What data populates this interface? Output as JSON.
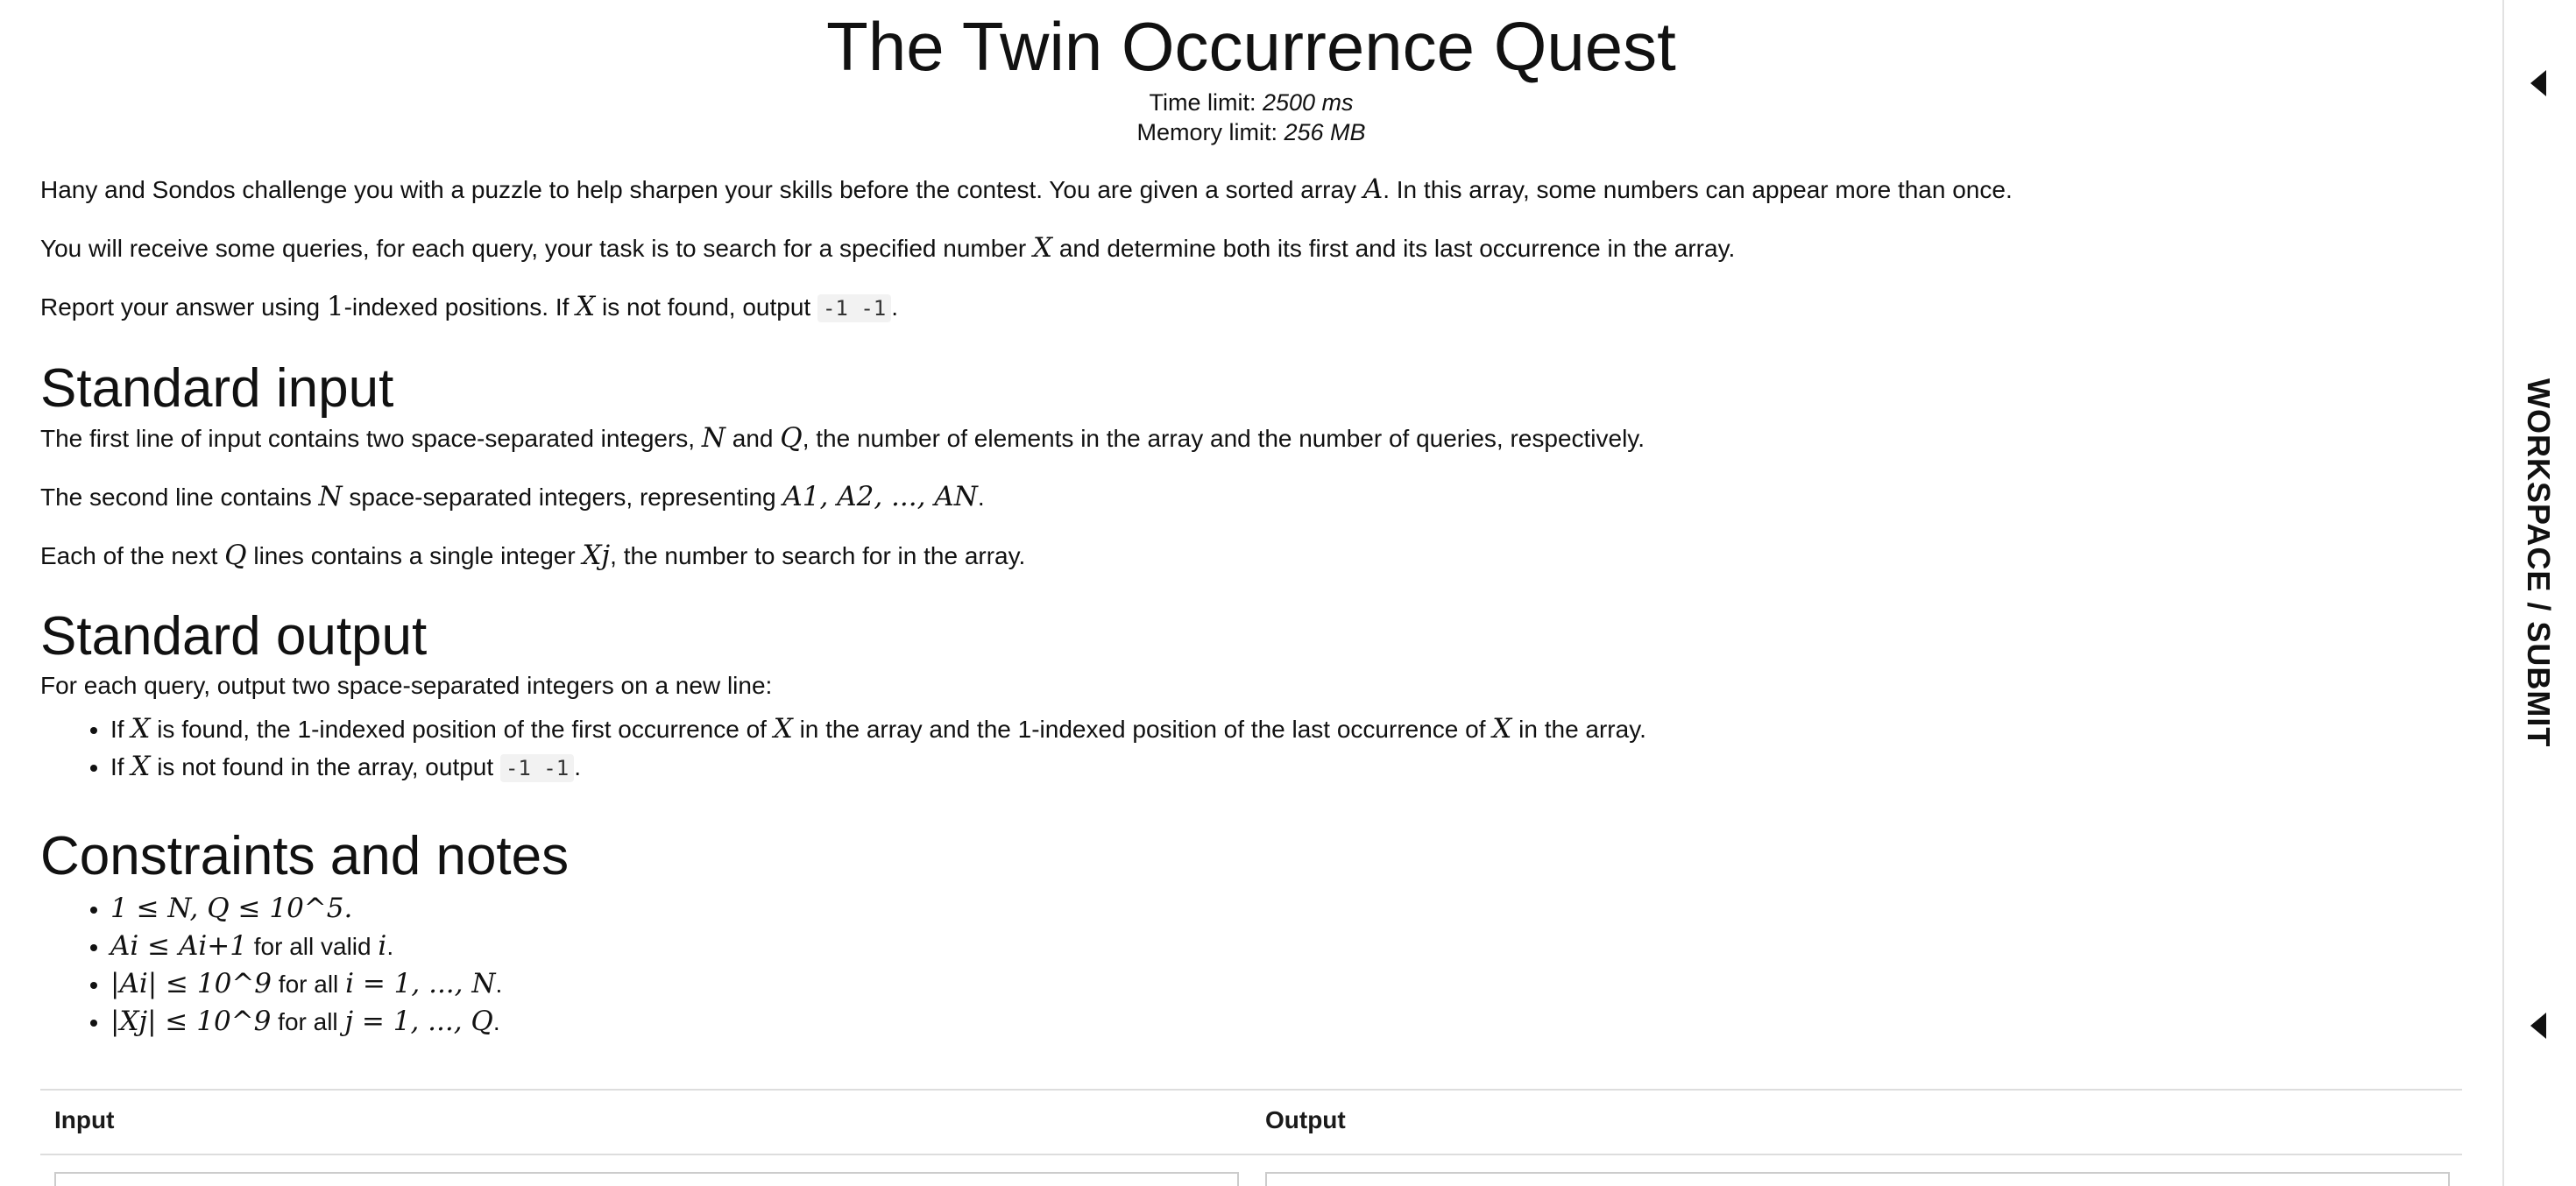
{
  "problem": {
    "title": "The Twin Occurrence Quest",
    "time_limit_label": "Time limit: ",
    "time_limit_value": "2500 ms",
    "memory_limit_label": "Memory limit: ",
    "memory_limit_value": "256 MB"
  },
  "statement": {
    "p1_a": "Hany and Sondos challenge you with a puzzle to help sharpen your skills before the contest. You are given a sorted array ",
    "p1_var": "A",
    "p1_b": ". In this array, some numbers can appear more than once.",
    "p2_a": "You will receive some queries, for each query, your task is to search for a specified number ",
    "p2_var": "X",
    "p2_b": " and determine both its first and its last occurrence in the array.",
    "p3_a": "Report your answer using ",
    "p3_num": "1",
    "p3_b": "-indexed positions. If ",
    "p3_var": "X",
    "p3_c": " is not found, output ",
    "p3_code": "-1 -1",
    "p3_d": "."
  },
  "input_section": {
    "heading": "Standard input",
    "p1_a": "The first line of input contains two space-separated integers, ",
    "p1_n": "N",
    "p1_b": " and ",
    "p1_q": "Q",
    "p1_c": ", the number of elements in the array and the number of queries, respectively.",
    "p2_a": "The second line contains ",
    "p2_n": "N",
    "p2_b": " space-separated integers, representing ",
    "p2_math": "A1, A2, ..., AN",
    "p2_c": ".",
    "p3_a": "Each of the next ",
    "p3_q": "Q",
    "p3_b": " lines contains a single integer ",
    "p3_x": "Xj",
    "p3_c": ", the number to search for in the array."
  },
  "output_section": {
    "heading": "Standard output",
    "intro": "For each query, output two space-separated integers on a new line:",
    "b1_a": "If ",
    "b1_x1": "X",
    "b1_b": " is found, the 1-indexed position of the first occurrence of ",
    "b1_x2": "X",
    "b1_c": " in the array and the 1-indexed position of the last occurrence of ",
    "b1_x3": "X",
    "b1_d": " in the array.",
    "b2_a": "If ",
    "b2_x": "X",
    "b2_b": " is not found in the array, output ",
    "b2_code": "-1 -1",
    "b2_c": "."
  },
  "constraints": {
    "heading": "Constraints and notes",
    "c1": "1 ≤ N, Q ≤ 10^5.",
    "c2_math": "Ai ≤ Ai+1",
    "c2_text": " for all valid ",
    "c2_var": "i",
    "c2_end": ".",
    "c3_math": "|Ai| ≤ 10^9",
    "c3_text": " for all ",
    "c3_math2": "i = 1, ..., N",
    "c3_end": ".",
    "c4_math": "|Xj| ≤ 10^9",
    "c4_text": " for all ",
    "c4_math2": "j = 1, ..., Q",
    "c4_end": "."
  },
  "examples": {
    "input_label": "Input",
    "output_label": "Output"
  },
  "sidebar": {
    "workspace_label": "WORKSPACE / SUBMIT",
    "top_icon": "collapse-left-arrow-icon",
    "bottom_icon": "collapse-left-arrow-icon"
  }
}
